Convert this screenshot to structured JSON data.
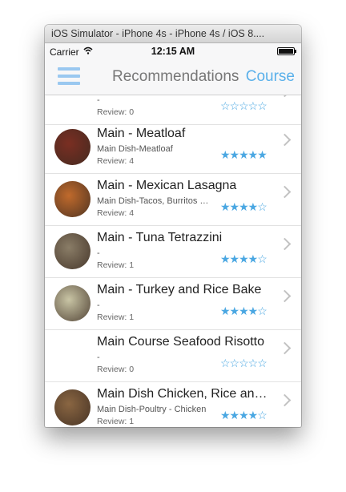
{
  "window": {
    "title": "iOS Simulator - iPhone 4s - iPhone 4s / iOS 8...."
  },
  "status_bar": {
    "carrier": "Carrier",
    "time": "12:15 AM"
  },
  "nav": {
    "title": "Recommendations",
    "right_label": "Course"
  },
  "rows": [
    {
      "title": "",
      "subtitle": "-",
      "review": "Review: 0",
      "rating": 0,
      "stars": "☆☆☆☆☆",
      "thumb_color": ""
    },
    {
      "title": "Main - Meatloaf",
      "subtitle": "Main Dish-Meatloaf",
      "review": "Review: 4",
      "rating": 5,
      "stars": "★★★★★",
      "thumb_color": "#7a2e22"
    },
    {
      "title": "Main - Mexican Lasagna",
      "subtitle": "Main Dish-Tacos, Burritos and Enchiladas",
      "review": "Review: 4",
      "rating": 4,
      "stars": "★★★★☆",
      "thumb_color": "#c06a2c"
    },
    {
      "title": "Main - Tuna Tetrazzini",
      "subtitle": "-",
      "review": "Review: 1",
      "rating": 4,
      "stars": "★★★★☆",
      "thumb_color": "#8a7d67"
    },
    {
      "title": "Main - Turkey and Rice Bake",
      "subtitle": "-",
      "review": "Review: 1",
      "rating": 4,
      "stars": "★★★★☆",
      "thumb_color": "#c9c5a5"
    },
    {
      "title": "Main Course Seafood Risotto",
      "subtitle": "-",
      "review": "Review: 0",
      "rating": 0,
      "stars": "☆☆☆☆☆",
      "thumb_color": ""
    },
    {
      "title": "Main Dish Chicken, Rice and Broccoli",
      "subtitle": "Main Dish-Poultry - Chicken",
      "review": "Review: 1",
      "rating": 4,
      "stars": "★★★★☆",
      "thumb_color": "#8a6642"
    }
  ]
}
